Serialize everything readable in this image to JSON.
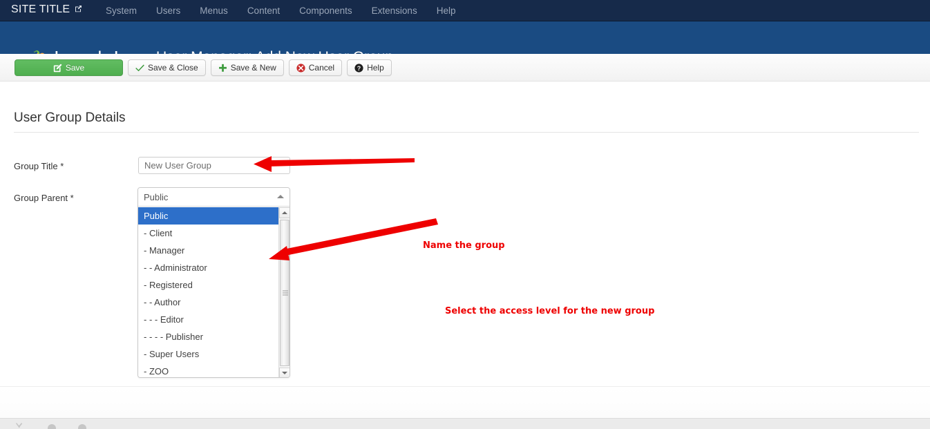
{
  "topbar": {
    "site_title": "SITE TITLE",
    "site_title_icon": "external-link-edit-icon",
    "menu": [
      {
        "label": "System"
      },
      {
        "label": "Users"
      },
      {
        "label": "Menus"
      },
      {
        "label": "Content"
      },
      {
        "label": "Components"
      },
      {
        "label": "Extensions"
      },
      {
        "label": "Help"
      }
    ]
  },
  "header": {
    "logo_text": "Joomla!",
    "logo_icon": "joomla-logo-icon",
    "page_title": "User Manager: Add New User Group"
  },
  "toolbar": {
    "buttons": [
      {
        "label": "Save",
        "icon": "pencil-square-icon",
        "style": "primary-green"
      },
      {
        "label": "Save & Close",
        "icon": "check-icon",
        "style": "default"
      },
      {
        "label": "Save & New",
        "icon": "plus-icon",
        "style": "default"
      },
      {
        "label": "Cancel",
        "icon": "cancel-circle-icon",
        "style": "default"
      },
      {
        "label": "Help",
        "icon": "question-circle-icon",
        "style": "default"
      }
    ]
  },
  "form": {
    "section_title": "User Group Details",
    "group_title": {
      "label": "Group Title *",
      "value": "New User Group",
      "placeholder": "New User Group"
    },
    "group_parent": {
      "label": "Group Parent *",
      "selected": "Public",
      "options": [
        {
          "label": "Public",
          "selected": true
        },
        {
          "label": "- Client",
          "selected": false
        },
        {
          "label": "- Manager",
          "selected": false
        },
        {
          "label": "- - Administrator",
          "selected": false
        },
        {
          "label": "- Registered",
          "selected": false
        },
        {
          "label": "- - Author",
          "selected": false
        },
        {
          "label": "- - - Editor",
          "selected": false
        },
        {
          "label": "- - - - Publisher",
          "selected": false
        },
        {
          "label": "- Super Users",
          "selected": false
        },
        {
          "label": "- ZOO",
          "selected": false
        }
      ]
    }
  },
  "annotations": [
    {
      "text": "Name the group",
      "color": "#ee0000"
    },
    {
      "text": "Select the access level for the new group",
      "color": "#ee0000"
    }
  ],
  "colors": {
    "topbar": "#162a4a",
    "header": "#1a4b82",
    "save_green": "#4fae4f",
    "option_selected": "#2d6fc9",
    "annotation_red": "#ee0000"
  }
}
